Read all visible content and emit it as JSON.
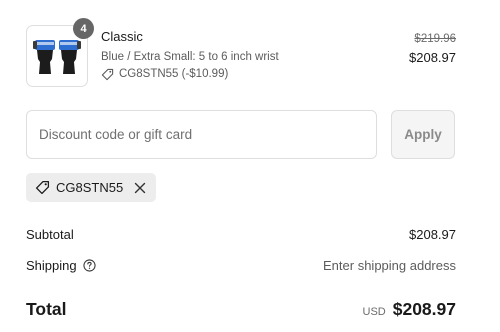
{
  "line_item": {
    "quantity": "4",
    "name": "Classic",
    "variant": "Blue / Extra Small: 5 to 6 inch wrist",
    "discount_line": "CG8STN55 (-$10.99)",
    "compare_price": "$219.96",
    "price": "$208.97",
    "thumbnail_icon": "product-wrist-wraps-image"
  },
  "discount": {
    "placeholder": "Discount code or gift card",
    "value": "",
    "apply_label": "Apply"
  },
  "applied_code": {
    "code": "CG8STN55",
    "tag_icon": "tag-icon",
    "remove_icon": "close-icon"
  },
  "summary": {
    "subtotal_label": "Subtotal",
    "subtotal_value": "$208.97",
    "shipping_label": "Shipping",
    "shipping_value": "Enter shipping address",
    "total_label": "Total",
    "currency": "USD",
    "total_value": "$208.97"
  },
  "colors": {
    "badge": "#666666",
    "border": "#dedede",
    "apply_bg": "#f5f5f5",
    "tag_bg": "#ededed",
    "product_blue": "#2f6ed1",
    "product_dark": "#1c1c1c"
  }
}
